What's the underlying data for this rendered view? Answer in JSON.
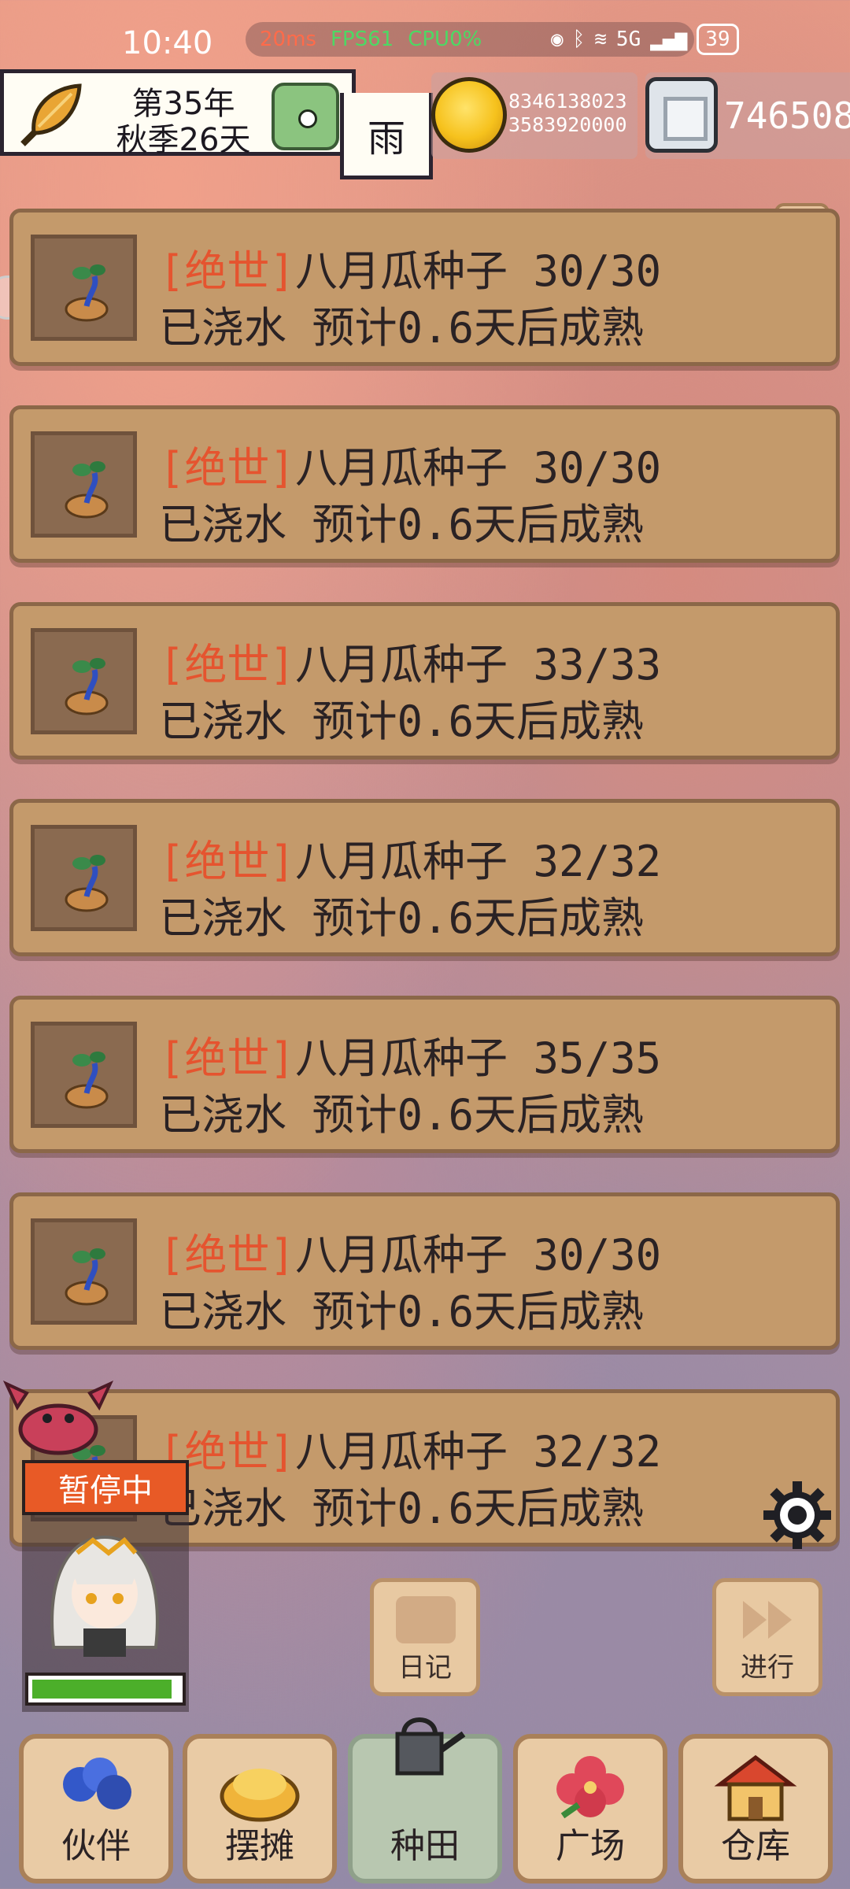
{
  "status_bar": {
    "time": "10:40",
    "ping": "20ms",
    "fps": "FPS61",
    "cpu": "CPU0%",
    "network": "5G",
    "battery": "39"
  },
  "hud": {
    "year": "第35年",
    "season_day": "秋季26天",
    "weather": "雨",
    "gold_line1": "8346138023",
    "gold_line2": "3583920000",
    "silver": "746508"
  },
  "help": {
    "label": "?"
  },
  "plots": [
    {
      "quality": "[绝世]",
      "name": "八月瓜种子",
      "count": "30/30",
      "status": "已浇水 预计0.6天后成熟"
    },
    {
      "quality": "[绝世]",
      "name": "八月瓜种子",
      "count": "30/30",
      "status": "已浇水 预计0.6天后成熟"
    },
    {
      "quality": "[绝世]",
      "name": "八月瓜种子",
      "count": "33/33",
      "status": "已浇水 预计0.6天后成熟"
    },
    {
      "quality": "[绝世]",
      "name": "八月瓜种子",
      "count": "32/32",
      "status": "已浇水 预计0.6天后成熟"
    },
    {
      "quality": "[绝世]",
      "name": "八月瓜种子",
      "count": "35/35",
      "status": "已浇水 预计0.6天后成熟"
    },
    {
      "quality": "[绝世]",
      "name": "八月瓜种子",
      "count": "30/30",
      "status": "已浇水 预计0.6天后成熟"
    },
    {
      "quality": "[绝世]",
      "name": "八月瓜种子",
      "count": "32/32",
      "status": "已浇水 预计0.6天后成熟"
    }
  ],
  "controls": {
    "paused": "暂停中",
    "stamina": 0.95,
    "diary": "日记",
    "proceed": "进行"
  },
  "nav": {
    "partner": "伙伴",
    "stall": "摆摊",
    "farm": "种田",
    "plaza": "广场",
    "warehouse": "仓库"
  },
  "colors": {
    "quality": "#e5542f",
    "card": "#c49a6b",
    "card_border": "#8b6748",
    "paused": "#e85a26"
  }
}
